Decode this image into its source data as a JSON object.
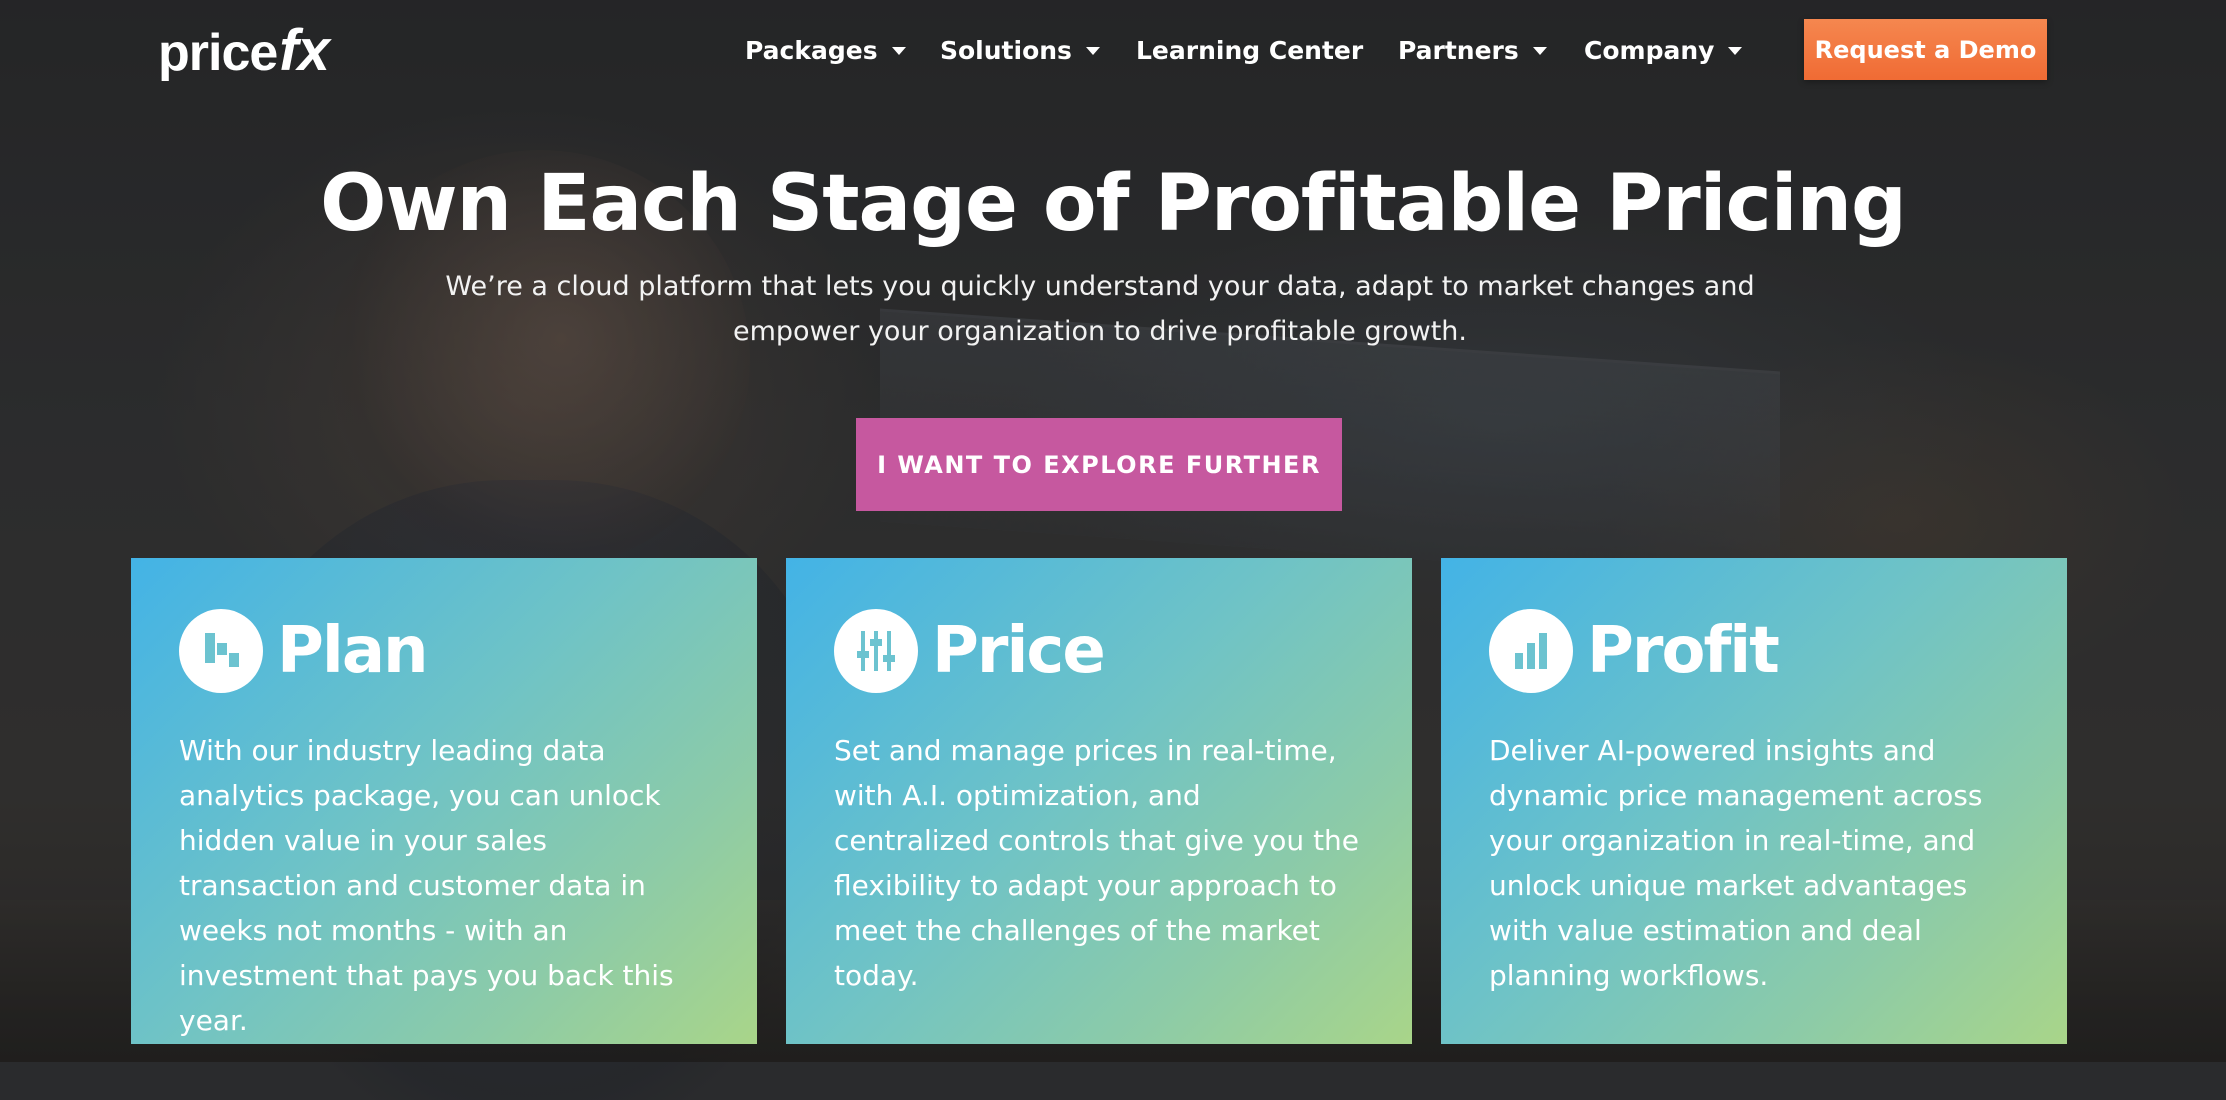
{
  "brand": {
    "logo_text_main": "price",
    "logo_text_accent": "fx"
  },
  "nav": {
    "items": [
      {
        "label": "Packages",
        "has_dropdown": true
      },
      {
        "label": "Solutions",
        "has_dropdown": true
      },
      {
        "label": "Learning Center",
        "has_dropdown": false
      },
      {
        "label": "Partners",
        "has_dropdown": true
      },
      {
        "label": "Company",
        "has_dropdown": true
      }
    ],
    "cta_label": "Request a Demo"
  },
  "hero": {
    "title": "Own Each Stage of Profitable Pricing",
    "subtitle": "We’re a cloud platform that lets you quickly understand your data, adapt to market changes and empower your organization to drive profitable growth.",
    "button_label": "I WANT TO EXPLORE FURTHER"
  },
  "cards": [
    {
      "title": "Plan",
      "icon": "plan-icon",
      "text": "With our industry leading data analytics package, you can unlock hidden value in your sales transaction and customer data in weeks not months - with an investment that pays you back this year."
    },
    {
      "title": "Price",
      "icon": "sliders-icon",
      "text": "Set and manage prices in real-time, with A.I. optimization, and centralized controls that give you the flexibility to adapt your approach to meet the challenges of the market today."
    },
    {
      "title": "Profit",
      "icon": "bar-chart-icon",
      "text": "Deliver AI-powered insights and dynamic price management across your organization in real-time, and unlock unique market advantages with value estimation and deal planning workflows."
    }
  ],
  "colors": {
    "demo_button": "#f06b34",
    "explore_button": "#c6589f",
    "card_gradient_start": "#43b3e6",
    "card_gradient_end": "#a9d589"
  }
}
